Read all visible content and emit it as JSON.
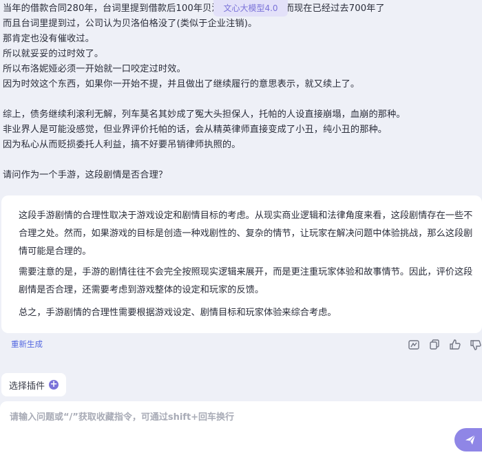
{
  "model_badge": "文心大模型4.0",
  "user_message": {
    "lines": [
      "当年的借款合同280年，台词里提到借款后100年贝洛伯格就倒闭了，而现在已经过去700年了",
      "而且台词里提到过，公司认为贝洛伯格没了(类似于企业注销)。",
      "那肯定也没有催收过。",
      "所以就妥妥的过时效了。",
      "所以布洛妮娅必须一开始就一口咬定过时效。",
      "因为时效这个东西，如果你一开始不提，并且做出了继续履行的意思表示，就又续上了。",
      "",
      "综上，债务继续利滚利无解，列车莫名其妙成了冤大头担保人，托帕的人设直接崩塌，血崩的那种。",
      "非业界人是可能没感觉，但业界评价托帕的话，会从精英律师直接变成了小丑，纯小丑的那种。",
      "因为私心从而贬损委托人利益，搞不好要吊销律师执照的。",
      "",
      "请问作为一个手游，这段剧情是否合理？"
    ]
  },
  "answer": {
    "paragraphs": [
      "这段手游剧情的合理性取决于游戏设定和剧情目标的考虑。从现实商业逻辑和法律角度来看，这段剧情存在一些不合理之处。然而，如果游戏的目标是创造一种戏剧性的、复杂的情节，让玩家在解决问题中体验挑战，那么这段剧情可能是合理的。",
      "需要注意的是，手游的剧情往往不会完全按照现实逻辑来展开，而是更注重玩家体验和故事情节。因此，评价这段剧情是否合理，还需要考虑到游戏整体的设定和玩家的反馈。",
      "总之，手游剧情的合理性需要根据游戏设定、剧情目标和玩家体验来综合考虑。"
    ]
  },
  "footer": {
    "regenerate_label": "重新生成",
    "action_icons": [
      "chart-icon",
      "copy-icon",
      "thumbs-up-icon",
      "thumbs-down-icon"
    ]
  },
  "plugin": {
    "label": "选择插件",
    "plus": "+"
  },
  "input": {
    "placeholder": "请输入问题或“/”获取收藏指令，可通过shift+回车换行",
    "value": ""
  },
  "colors": {
    "accent": "#7b73d9",
    "link": "#5468e0",
    "background": "#eef0f7"
  }
}
